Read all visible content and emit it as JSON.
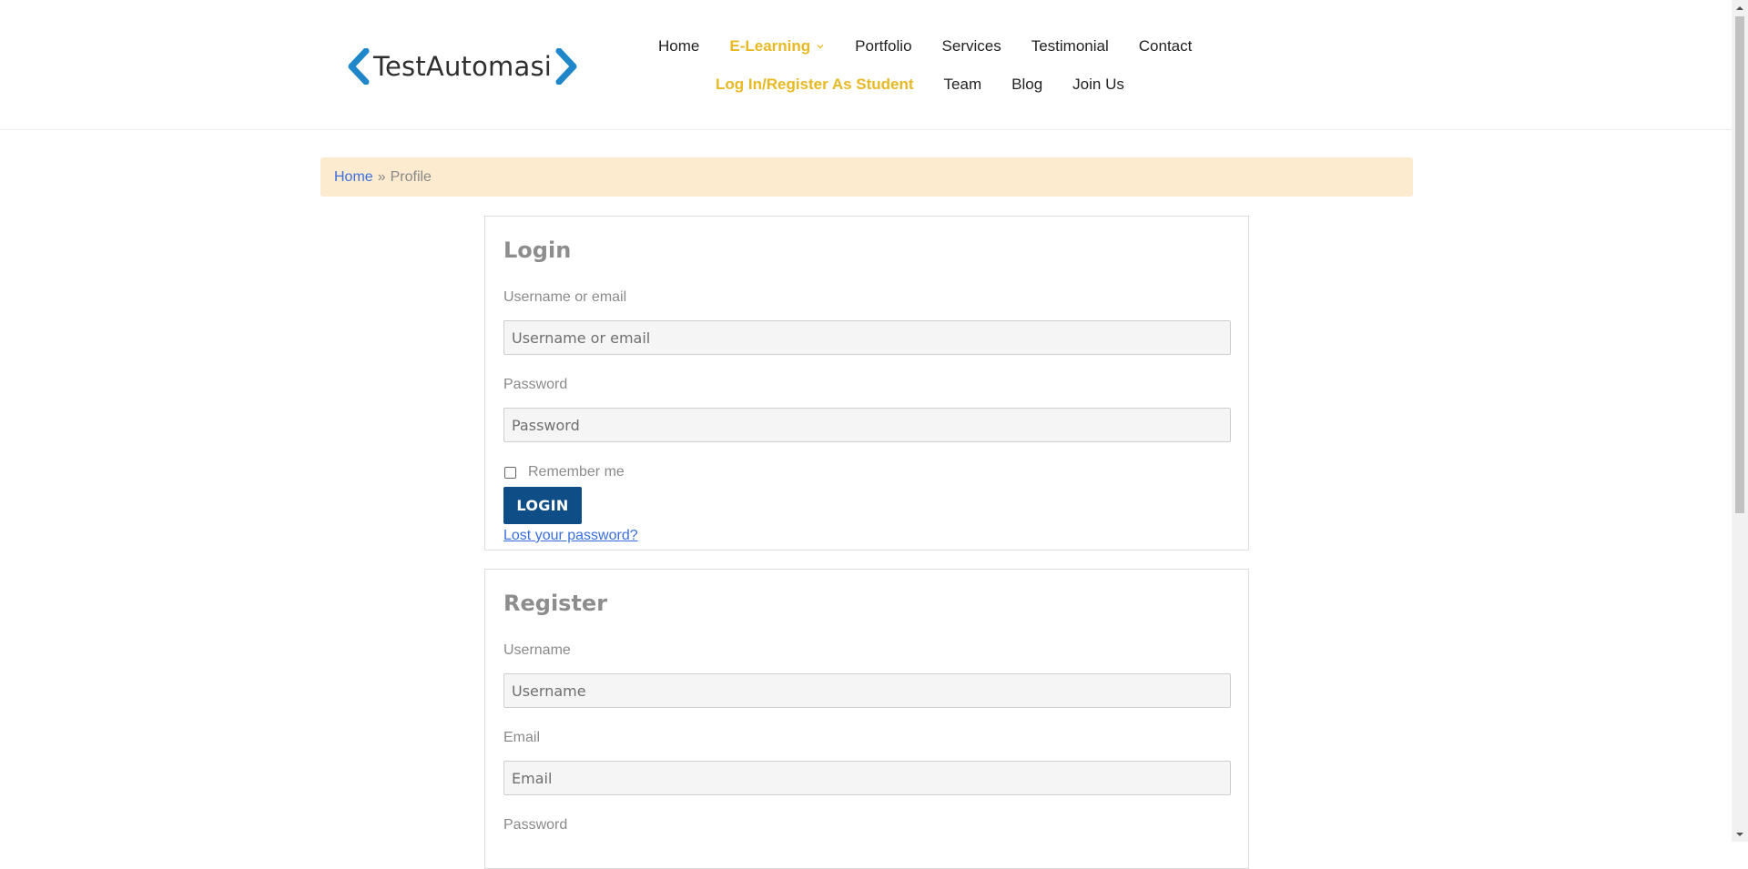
{
  "brand": {
    "logo_text": "TestAutomasi",
    "accent_color": "#1f86c9"
  },
  "nav": {
    "row1": [
      {
        "label": "Home"
      },
      {
        "label": "E-Learning",
        "active": true,
        "has_dropdown": true
      },
      {
        "label": "Portfolio"
      },
      {
        "label": "Services"
      },
      {
        "label": "Testimonial"
      },
      {
        "label": "Contact"
      }
    ],
    "row2": [
      {
        "label": "Log In/Register As Student",
        "active": true
      },
      {
        "label": "Team"
      },
      {
        "label": "Blog"
      },
      {
        "label": "Join Us"
      }
    ],
    "active_color": "#e8b923"
  },
  "breadcrumb": {
    "home": "Home",
    "separator": "»",
    "current": "Profile"
  },
  "login": {
    "title": "Login",
    "username_label": "Username or email",
    "username_placeholder": "Username or email",
    "password_label": "Password",
    "password_placeholder": "Password",
    "remember_label": "Remember me",
    "remember_checked": false,
    "button_label": "LOGIN",
    "lost_password": "Lost your password?"
  },
  "register": {
    "title": "Register",
    "username_label": "Username",
    "username_placeholder": "Username",
    "email_label": "Email",
    "email_placeholder": "Email",
    "password_label": "Password"
  },
  "colors": {
    "button": "#0e4d85",
    "link": "#3b6fe0",
    "breadcrumb_bg": "#fdebcf"
  }
}
